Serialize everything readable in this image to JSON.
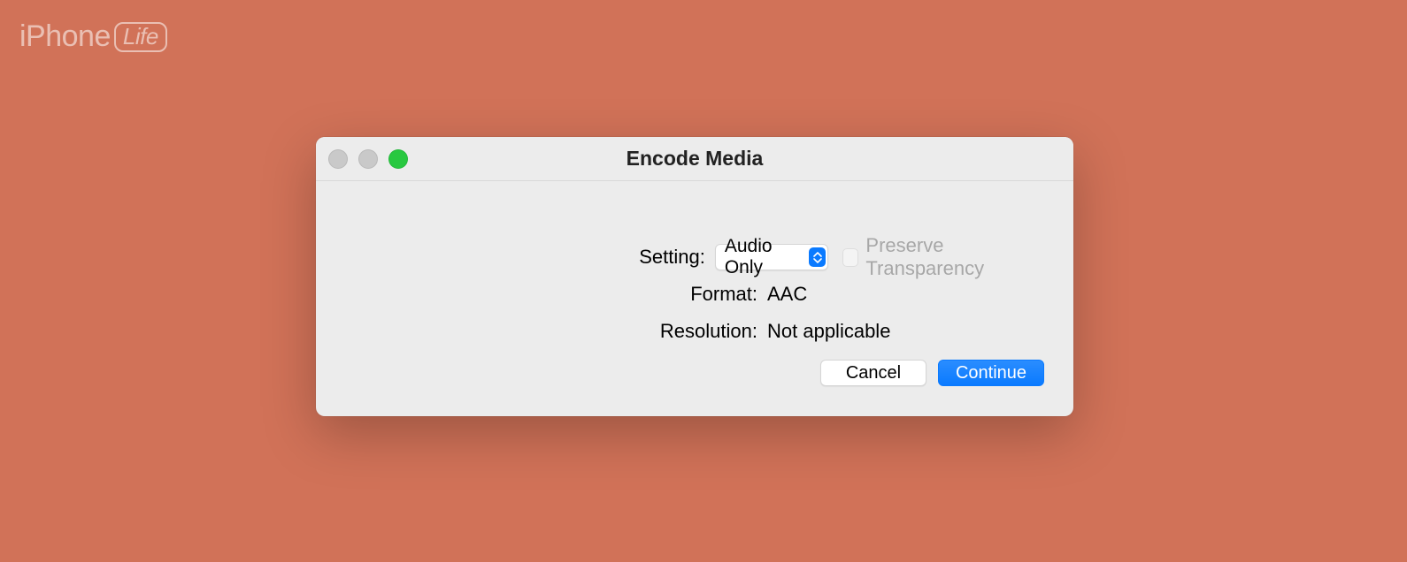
{
  "watermark": {
    "brand_prefix": "iPhone",
    "brand_badge": "Life"
  },
  "dialog": {
    "title": "Encode Media",
    "labels": {
      "setting": "Setting:",
      "format": "Format:",
      "resolution": "Resolution:"
    },
    "setting_value": "Audio Only",
    "preserve_transparency_label": "Preserve Transparency",
    "format_value": "AAC",
    "resolution_value": "Not applicable",
    "buttons": {
      "cancel": "Cancel",
      "continue": "Continue"
    }
  }
}
